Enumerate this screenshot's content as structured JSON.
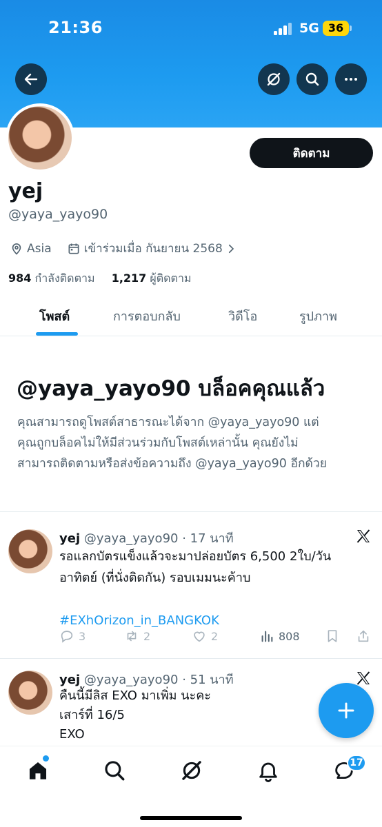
{
  "status_bar": {
    "time": "21:36",
    "network": "5G",
    "battery": "36"
  },
  "profile": {
    "display_name": "yej",
    "handle": "@yaya_yayo90",
    "location": "Asia",
    "joined": "เข้าร่วมเมื่อ กันยายน 2568",
    "following_count": "984",
    "following_label": "กำลังติดตาม",
    "followers_count": "1,217",
    "followers_label": "ผู้ติดตาม",
    "follow_button": "ติดตาม"
  },
  "tabs": [
    {
      "label": "โพสต์",
      "active": true
    },
    {
      "label": "การตอบกลับ",
      "active": false
    },
    {
      "label": "วิดีโอ",
      "active": false
    },
    {
      "label": "รูปภาพ",
      "active": false
    }
  ],
  "blocked": {
    "title": "@yaya_yayo90 บล็อคคุณแล้ว",
    "line1": "คุณสามารถดูโพสต์สาธารณะได้จาก @yaya_yayo90 แต่",
    "line2": "คุณถูกบล็อคไม่ให้มีส่วนร่วมกับโพสต์เหล่านั้น คุณยังไม่",
    "line3": "สามารถติดตามหรือส่งข้อความถึง @yaya_yayo90 อีกด้วย"
  },
  "posts": [
    {
      "name": "yej",
      "handle": "@yaya_yayo90",
      "time": "· 17 นาที",
      "line1": "รอแลกบัตรแข็งแล้วจะมาปล่อยบัตร 6,500  2ใบ/วัน",
      "line2": "อาทิตย์ (ที่นั่งติดกัน) รอบเมมนะค้าบ",
      "hashtag": "#EXhOrizon_in_BANGKOK",
      "replies": "3",
      "reposts": "2",
      "likes": "2",
      "views": "808"
    },
    {
      "name": "yej",
      "handle": "@yaya_yayo90",
      "time": "· 51 นาที",
      "line1": "คืนนี้มีลิส EXO มาเพิ่ม นะคะ",
      "line2": "เสาร์ที่ 16/5",
      "line3": "EXO"
    }
  ],
  "nav": {
    "messages_badge": "17"
  },
  "colors": {
    "accent": "#1d9bf0",
    "text": "#0f1419",
    "muted": "#536471"
  }
}
